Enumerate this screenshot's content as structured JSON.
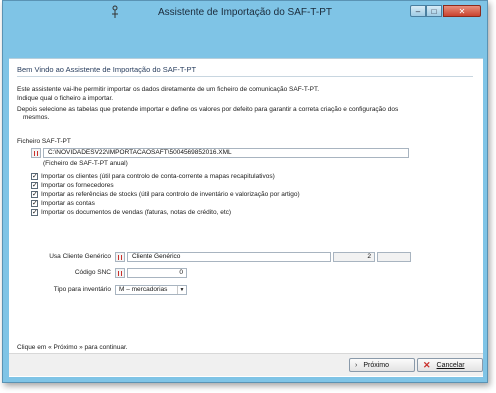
{
  "window": {
    "title": "Assistente de Importação do SAF-T-PT",
    "minimize_icon": "minimize-icon",
    "maximize_icon": "maximize-icon",
    "close_icon": "close-icon"
  },
  "wizard": {
    "welcome_title": "Bem Vindo ao Assistente de Importação do SAF-T-PT",
    "intro_line1": "Este assistente vai-lhe permitir importar os dados diretamente de um ficheiro de comunicação SAF-T-PT.",
    "intro_line2": "Indique qual o ficheiro a importar.",
    "intro_line3": "Depois selecione as tabelas que pretende importar e define os valores por defeito para garantir a correta criação e configuração dos",
    "intro_line4": "mesmos."
  },
  "file": {
    "label": "Ficheiro  SAF-T-PT",
    "path": "C:\\NOVIDADESV22\\IMPORTACAOSAFT\\5004569852016.XML",
    "subtitle": "(Ficheiro de SAF-T-PT anual)"
  },
  "options": [
    {
      "label": "Importar os clientes (útil para controlo de conta-corrente a mapas recapitulativos)",
      "checked": true
    },
    {
      "label": "Importar os fornecedores",
      "checked": true
    },
    {
      "label": "Importar as referências de stocks (útil para controlo de inventário e valorização por artigo)",
      "checked": true
    },
    {
      "label": "Importar as contas",
      "checked": true
    },
    {
      "label": "Importar os documentos de vendas (faturas, notas de crédito, etc)",
      "checked": true
    }
  ],
  "defaults": {
    "generic_client_label": "Usa Cliente Genérico",
    "generic_client_name": "Cliente Genérico",
    "generic_client_number": "2",
    "snc_label": "Código SNC",
    "snc_value": "0",
    "inventory_label": "Tipo para inventário",
    "inventory_value": "M – mercadorias"
  },
  "footer": {
    "hint": "Clique em « Próximo » para continuar.",
    "next_label": "Próximo",
    "cancel_label": "Cancelar"
  },
  "colors": {
    "title_band": "#7fc4e6",
    "close_button": "#c9432f"
  }
}
